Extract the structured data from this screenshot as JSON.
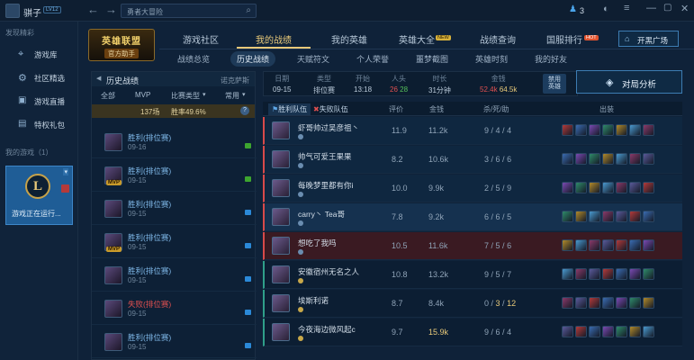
{
  "titlebar": {
    "username": "骐子",
    "badge": "LV12",
    "search_placeholder": "勇者大冒险",
    "notif_count": "3"
  },
  "banner": {
    "logo_line1": "英雄联盟",
    "logo_line2": "官方助手"
  },
  "sidebar": {
    "section1": "发现精彩",
    "items": [
      {
        "label": "游戏库",
        "icon": "crosshair-icon"
      },
      {
        "label": "社区精选",
        "icon": "gear-icon"
      },
      {
        "label": "游戏直播",
        "icon": "tv-icon"
      },
      {
        "label": "特权礼包",
        "icon": "gift-icon"
      }
    ],
    "section2": "我的游戏（1）",
    "game_status": "游戏正在运行..."
  },
  "tabs": [
    "游戏社区",
    "我的战绩",
    "我的英雄",
    "英雄大全",
    "战绩查询",
    "国服排行"
  ],
  "active_tab": "我的战绩",
  "tab_new": "NEW",
  "tab_hot": "HOT",
  "open_plaza": "开黑广场",
  "subtabs": [
    "战绩总览",
    "历史战绩",
    "天赋符文",
    "个人荣誉",
    "噩梦截图",
    "英雄时刻",
    "我的好友"
  ],
  "active_subtab": "历史战绩",
  "history": {
    "title": "历史战绩",
    "server": "诺克萨斯",
    "filters": [
      "全部",
      "MVP",
      "比赛类型",
      "常用"
    ],
    "count": "137场",
    "winrate": "胜率49.6%",
    "help": "?",
    "matches": [
      {
        "result": "胜利(排位赛)",
        "date": "09-16",
        "mvp": false,
        "mode_color": "#3da52f",
        "win": true
      },
      {
        "result": "胜利(排位赛)",
        "date": "09-15",
        "mvp": true,
        "mode_color": "#3da52f",
        "win": true
      },
      {
        "result": "胜利(排位赛)",
        "date": "09-15",
        "mvp": false,
        "mode_color": "#2b89d8",
        "win": true
      },
      {
        "result": "胜利(排位赛)",
        "date": "09-15",
        "mvp": true,
        "mode_color": "#2b89d8",
        "win": true
      },
      {
        "result": "胜利(排位赛)",
        "date": "09-15",
        "mvp": false,
        "mode_color": "#2b89d8",
        "win": true
      },
      {
        "result": "失败(排位赛)",
        "date": "09-15",
        "mvp": false,
        "mode_color": "#2b89d8",
        "win": false
      },
      {
        "result": "胜利(排位赛)",
        "date": "09-15",
        "mvp": false,
        "mode_color": "#2b89d8",
        "win": true
      }
    ]
  },
  "stats": {
    "labels": [
      "日期",
      "类型",
      "开始",
      "人头",
      "时长",
      "金钱",
      "禁用英雄"
    ],
    "date": "09-15",
    "type": "排位赛",
    "start": "13:18",
    "kills_blue": "26",
    "kills_red": "28",
    "duration": "31分钟",
    "gold_blue": "52.4k",
    "gold_red": "64.5k"
  },
  "analyze_label": "对局分析",
  "table": {
    "team_win": "胜利队伍",
    "team_lose": "失败队伍",
    "headers": [
      "评价",
      "金钱",
      "杀/死/助",
      "出装"
    ],
    "rows": [
      {
        "name": "虾哥帅过吴彦祖丶",
        "score": "11.9",
        "gold": "11.2k",
        "k": "9",
        "d": "4",
        "a": "4",
        "hl": false,
        "me": false
      },
      {
        "name": "帅气可爱王果果",
        "score": "8.2",
        "gold": "10.6k",
        "k": "3",
        "d": "6",
        "a": "6",
        "hl": false,
        "me": false
      },
      {
        "name": "每晚梦里都有你i",
        "score": "10.0",
        "gold": "9.9k",
        "k": "2",
        "d": "5",
        "a": "9",
        "hl": false,
        "me": false
      },
      {
        "name": "carry丶 Tea哥",
        "score": "7.8",
        "gold": "9.2k",
        "k": "6",
        "d": "6",
        "a": "5",
        "hl": true,
        "me": false
      },
      {
        "name": "想吃了我吗",
        "score": "10.5",
        "gold": "11.6k",
        "k": "7",
        "d": "5",
        "a": "6",
        "hl": false,
        "me": true
      },
      {
        "name": "安徽宿州无名之人",
        "score": "10.8",
        "gold": "13.2k",
        "k": "9",
        "d": "5",
        "a": "7",
        "hl": false,
        "me": false
      },
      {
        "name": "埃斯利诺",
        "score": "8.7",
        "gold": "8.4k",
        "k": "0",
        "d": "3",
        "a": "12",
        "hl": false,
        "me": false
      },
      {
        "name": "今夜海边微风起c",
        "score": "9.7",
        "gold": "15.9k",
        "k": "9",
        "d": "6",
        "a": "4",
        "hl": false,
        "me": false
      }
    ]
  },
  "colors": {
    "gold": "#e8c979",
    "win": "#7fb8e8",
    "lose": "#e05050",
    "accent": "#3d7cb2"
  }
}
